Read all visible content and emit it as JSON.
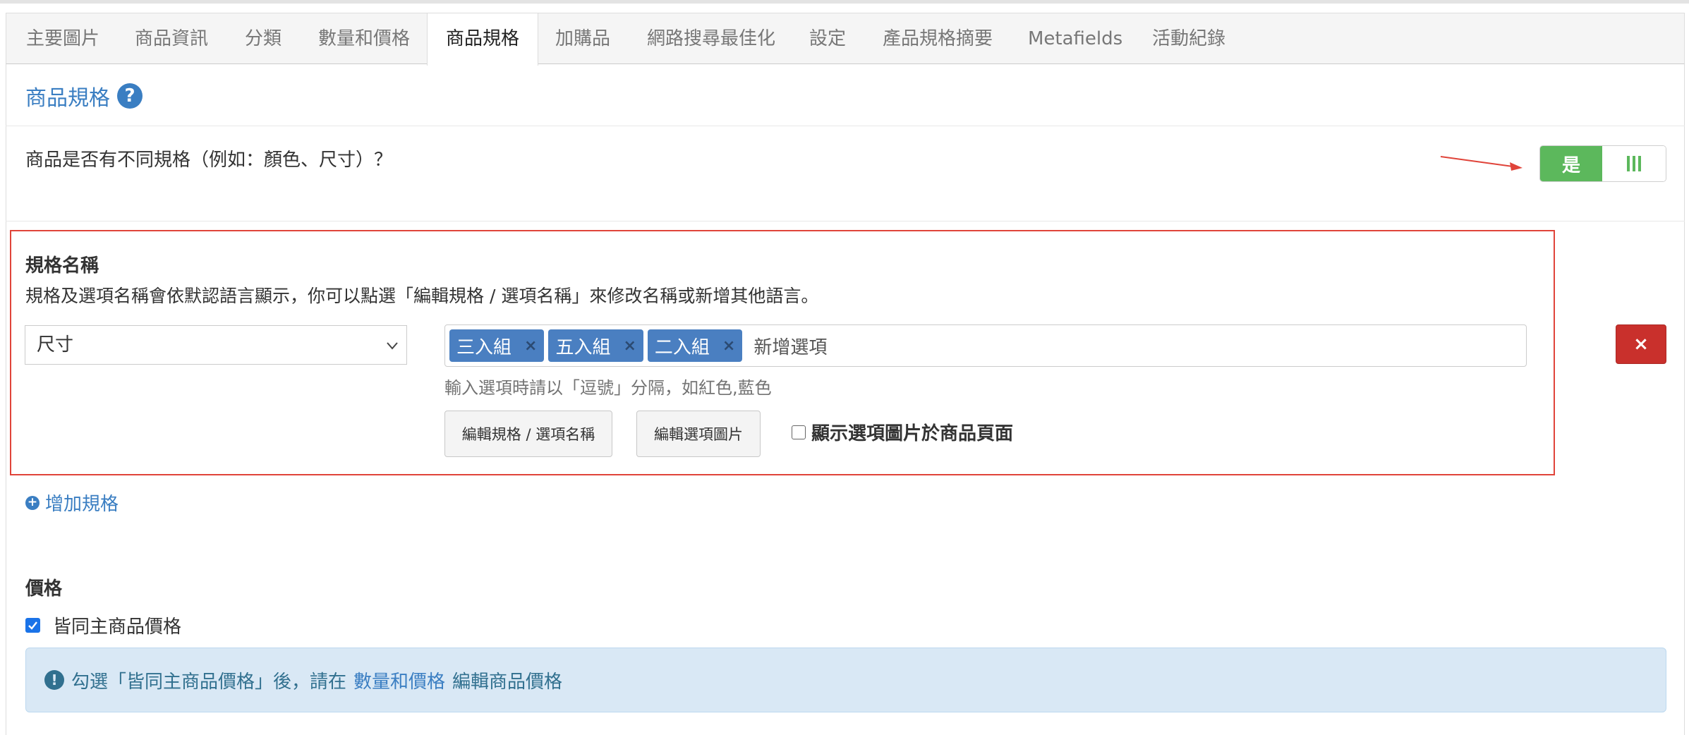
{
  "tabs": [
    {
      "label": "主要圖片",
      "active": false
    },
    {
      "label": "商品資訊",
      "active": false
    },
    {
      "label": "分類",
      "active": false
    },
    {
      "label": "數量和價格",
      "active": false
    },
    {
      "label": "商品規格",
      "active": true
    },
    {
      "label": "加購品",
      "active": false
    },
    {
      "label": "網路搜尋最佳化",
      "active": false
    },
    {
      "label": "設定",
      "active": false
    },
    {
      "label": "產品規格摘要",
      "active": false
    },
    {
      "label": "Metafields",
      "active": false
    },
    {
      "label": "活動紀錄",
      "active": false
    }
  ],
  "section": {
    "title": "商品規格",
    "help_icon": "question-circle-icon"
  },
  "variants_question": {
    "text": "商品是否有不同規格（例如：顏色、尺寸）？",
    "toggle_yes_label": "是",
    "toggle_on": true
  },
  "spec": {
    "label": "規格名稱",
    "description": "規格及選項名稱會依默認語言顯示，你可以點選「編輯規格 / 選項名稱」來修改名稱或新增其他語言。",
    "selected_name": "尺寸",
    "options": [
      "三入組",
      "五入組",
      "二入組"
    ],
    "tag_remove_symbol": "×",
    "add_option_placeholder": "新增選項",
    "hint": "輸入選項時請以「逗號」分隔，如紅色,藍色",
    "edit_spec_button": "編輯規格 / 選項名稱",
    "edit_image_button": "編輯選項圖片",
    "show_image_checkbox_label": "顯示選項圖片於商品頁面",
    "show_image_checked": false,
    "delete_symbol": "×"
  },
  "add_spec_label": "增加規格",
  "price": {
    "title": "價格",
    "same_price_label": "皆同主商品價格",
    "same_price_checked": true,
    "info_prefix": "勾選「皆同主商品價格」後，請在",
    "info_link": "數量和價格",
    "info_suffix": "編輯商品價格"
  },
  "colors": {
    "accent": "#3a7ec2",
    "toggle_green": "#5cb85c",
    "tag_blue": "#4a7fc1",
    "danger_red": "#c9302c",
    "highlight_border": "#e0443a",
    "info_bg": "#d9e8f5"
  }
}
